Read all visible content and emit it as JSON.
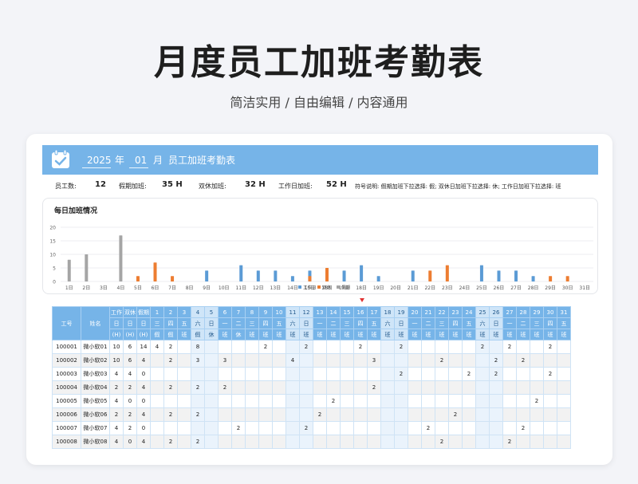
{
  "page": {
    "title": "月度员工加班考勤表",
    "subtitle": "简洁实用 / 自由编辑 / 内容通用"
  },
  "header": {
    "year": "2025",
    "year_unit": "年",
    "month": "01",
    "month_unit": "月",
    "sheet_title": "员工加班考勤表",
    "icon": "calendar-check-icon"
  },
  "stats": {
    "employee_count_label": "员工数:",
    "employee_count": "12",
    "holiday_ot_label": "假期加班:",
    "holiday_ot": "35 H",
    "weekend_ot_label": "双休加班:",
    "weekend_ot": "32 H",
    "workday_ot_label": "工作日加班:",
    "workday_ot": "52 H",
    "legend_note": "符号说明: 假期加班下拉选择: 假; 双休日加班下拉选择: 休; 工作日加班下拉选择: 班"
  },
  "chart_data": {
    "type": "bar",
    "title": "每日加班情况",
    "ylim": [
      0,
      20
    ],
    "yticks": [
      0,
      5,
      10,
      15,
      20
    ],
    "categories": [
      "1日",
      "2日",
      "3日",
      "4日",
      "5日",
      "6日",
      "7日",
      "8日",
      "9日",
      "10日",
      "11日",
      "12日",
      "13日",
      "14日",
      "15日",
      "16日",
      "17日",
      "18日",
      "19日",
      "20日",
      "21日",
      "22日",
      "23日",
      "24日",
      "25日",
      "26日",
      "27日",
      "28日",
      "29日",
      "30日",
      "31日"
    ],
    "series": [
      {
        "name": "工作日",
        "color": "#5b9bd5",
        "values": [
          0,
          0,
          0,
          0,
          0,
          0,
          0,
          0,
          4,
          0,
          6,
          4,
          4,
          2,
          4,
          4,
          4,
          6,
          2,
          0,
          4,
          0,
          0,
          0,
          6,
          4,
          4,
          2,
          0,
          0,
          0
        ]
      },
      {
        "name": "双休",
        "color": "#ed7d31",
        "values": [
          0,
          0,
          0,
          0,
          2,
          7,
          2,
          0,
          0,
          0,
          0,
          0,
          0,
          0,
          2,
          5,
          0,
          0,
          0,
          0,
          0,
          4,
          6,
          0,
          0,
          0,
          0,
          0,
          2,
          2,
          0
        ]
      },
      {
        "name": "假期",
        "color": "#a5a5a5",
        "values": [
          8,
          10,
          0,
          17,
          0,
          0,
          0,
          0,
          0,
          0,
          0,
          0,
          0,
          0,
          0,
          0,
          0,
          0,
          0,
          0,
          0,
          0,
          0,
          0,
          0,
          0,
          0,
          0,
          0,
          0,
          0
        ]
      }
    ],
    "legend_labels": [
      "工作日",
      "双休",
      "假期"
    ]
  },
  "table": {
    "col_id": "工号",
    "col_name": "姓名",
    "sum_headers": [
      {
        "l1": "工作",
        "l2": "日",
        "l3": "(H)"
      },
      {
        "l1": "双休",
        "l2": "日",
        "l3": "(H)"
      },
      {
        "l1": "假期",
        "l2": "日",
        "l3": "(H)"
      }
    ],
    "day_numbers": [
      "1",
      "2",
      "3",
      "4",
      "5",
      "6",
      "7",
      "8",
      "9",
      "10",
      "11",
      "12",
      "13",
      "14",
      "15",
      "16",
      "17",
      "18",
      "19",
      "20",
      "21",
      "22",
      "23",
      "24",
      "25",
      "26",
      "27",
      "28",
      "29",
      "30",
      "31"
    ],
    "weekdays": [
      "三",
      "四",
      "五",
      "六",
      "日",
      "一",
      "二",
      "三",
      "四",
      "五",
      "六",
      "日",
      "一",
      "二",
      "三",
      "四",
      "五",
      "六",
      "日",
      "一",
      "二",
      "三",
      "四",
      "五",
      "六",
      "日",
      "一",
      "二",
      "三",
      "四",
      "五"
    ],
    "day_types": [
      "假",
      "假",
      "班",
      "假",
      "休",
      "班",
      "休",
      "班",
      "班",
      "班",
      "班",
      "班",
      "班",
      "班",
      "班",
      "班",
      "班",
      "班",
      "班",
      "班",
      "班",
      "班",
      "班",
      "班",
      "班",
      "班",
      "班",
      "班",
      "班",
      "班",
      "班"
    ],
    "weekend_columns": [
      4,
      5,
      11,
      12,
      18,
      19,
      25,
      26
    ],
    "rows": [
      {
        "id": "100001",
        "name": "微小软01",
        "work": "10",
        "rest": "6",
        "holiday": "14",
        "days": [
          "4",
          "2",
          "",
          "8",
          "",
          "",
          "",
          "",
          "2",
          "",
          "",
          "2",
          "",
          "",
          "",
          "2",
          "",
          "",
          "2",
          "",
          "",
          "",
          "",
          "",
          "2",
          "",
          "2",
          "",
          "",
          "2",
          ""
        ]
      },
      {
        "id": "100002",
        "name": "微小软02",
        "work": "10",
        "rest": "6",
        "holiday": "4",
        "days": [
          "",
          "2",
          "",
          "3",
          "",
          "3",
          "",
          "",
          "",
          "",
          "4",
          "",
          "",
          "",
          "",
          "",
          "3",
          "",
          "",
          "",
          "",
          "2",
          "",
          "",
          "",
          "2",
          "",
          "2",
          "",
          "",
          ""
        ]
      },
      {
        "id": "100003",
        "name": "微小软03",
        "work": "4",
        "rest": "4",
        "holiday": "0",
        "days": [
          "",
          "",
          "",
          "",
          "",
          "",
          "",
          "",
          "",
          "",
          "",
          "",
          "",
          "",
          "",
          "",
          "",
          "",
          "2",
          "",
          "",
          "",
          "",
          "2",
          "",
          "2",
          "",
          "",
          "",
          "2",
          ""
        ]
      },
      {
        "id": "100004",
        "name": "微小软04",
        "work": "2",
        "rest": "2",
        "holiday": "4",
        "days": [
          "",
          "2",
          "",
          "2",
          "",
          "2",
          "",
          "",
          "",
          "",
          "",
          "",
          "",
          "",
          "",
          "",
          "2",
          "",
          "",
          "",
          "",
          "",
          "",
          "",
          "",
          "",
          "",
          "",
          "",
          "",
          ""
        ]
      },
      {
        "id": "100005",
        "name": "微小软05",
        "work": "4",
        "rest": "0",
        "holiday": "0",
        "days": [
          "",
          "",
          "",
          "",
          "",
          "",
          "",
          "",
          "",
          "",
          "",
          "",
          "",
          "2",
          "",
          "",
          "",
          "",
          "",
          "",
          "",
          "",
          "",
          "",
          "",
          "",
          "",
          "",
          "2",
          "",
          ""
        ]
      },
      {
        "id": "100006",
        "name": "微小软06",
        "work": "2",
        "rest": "2",
        "holiday": "4",
        "days": [
          "",
          "2",
          "",
          "2",
          "",
          "",
          "",
          "",
          "",
          "",
          "",
          "",
          "2",
          "",
          "",
          "",
          "",
          "",
          "",
          "",
          "",
          "",
          "2",
          "",
          "",
          "",
          "",
          "",
          "",
          "",
          ""
        ]
      },
      {
        "id": "100007",
        "name": "微小软07",
        "work": "4",
        "rest": "2",
        "holiday": "0",
        "days": [
          "",
          "",
          "",
          "",
          "",
          "",
          "2",
          "",
          "",
          "",
          "",
          "2",
          "",
          "",
          "",
          "",
          "",
          "",
          "",
          "",
          "2",
          "",
          "",
          "",
          "",
          "",
          "",
          "2",
          "",
          "",
          ""
        ]
      },
      {
        "id": "100008",
        "name": "微小软08",
        "work": "4",
        "rest": "0",
        "holiday": "4",
        "days": [
          "",
          "2",
          "",
          "2",
          "",
          "",
          "",
          "",
          "",
          "",
          "",
          "",
          "",
          "",
          "",
          "",
          "",
          "",
          "",
          "",
          "",
          "2",
          "",
          "",
          "",
          "",
          "2",
          "",
          "",
          "",
          ""
        ]
      }
    ]
  }
}
